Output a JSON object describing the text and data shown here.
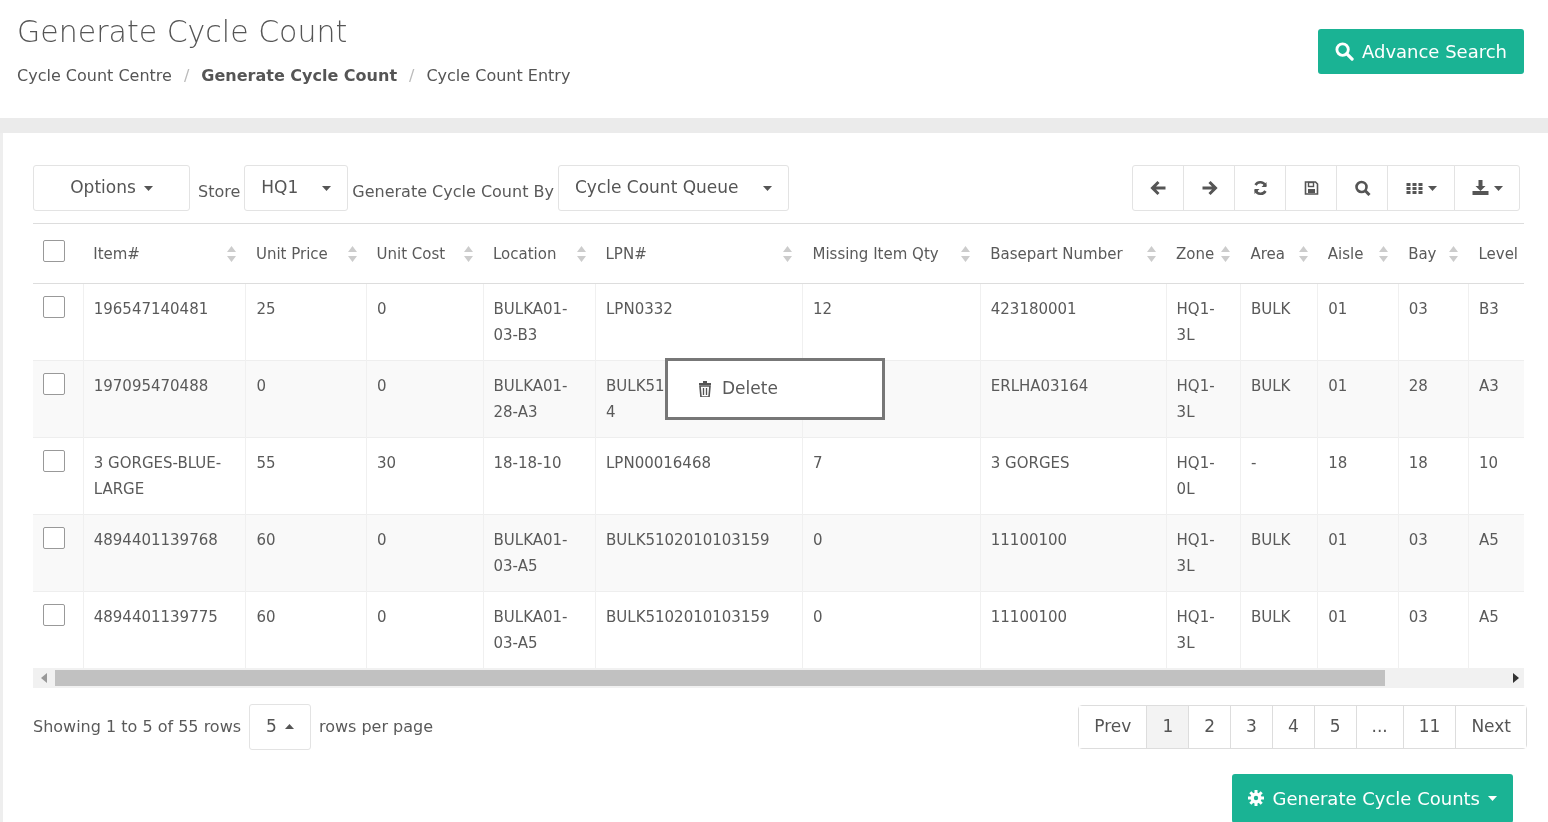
{
  "page_title": "Generate Cycle Count",
  "breadcrumb_separators": [
    "/",
    "/"
  ],
  "breadcrumbs": [
    {
      "label": "Cycle Count Centre",
      "current": false
    },
    {
      "label": "Generate Cycle Count",
      "current": true
    },
    {
      "label": "Cycle Count Entry",
      "current": false
    }
  ],
  "advance_search": {
    "label": "Advance Search"
  },
  "toolbar": {
    "options": "Options",
    "store_label": "Store",
    "store": "HQ1",
    "by_label": "Generate Cycle Count By",
    "by": "Cycle Count Queue"
  },
  "table": {
    "select_all_checked": false,
    "columns": [
      "Item#",
      "Unit Price",
      "Unit Cost",
      "Location",
      "LPN#",
      "Missing Item Qty",
      "Basepart Number",
      "Zone",
      "Area",
      "Aisle",
      "Bay",
      "Level"
    ],
    "rows": [
      {
        "checked": false,
        "cells": [
          "196547140481",
          "25",
          "0",
          "BULKA01-03-B3",
          "LPN0332",
          "12",
          "423180001",
          "HQ1-3L",
          "BULK",
          "01",
          "03",
          "B3"
        ]
      },
      {
        "checked": false,
        "cells": [
          "197095470488",
          "0",
          "0",
          "BULKA01-28-A3",
          "BULK51\n4",
          null,
          "ERLHA03164",
          "HQ1-3L",
          "BULK",
          "01",
          "28",
          "A3"
        ]
      },
      {
        "checked": false,
        "cells": [
          "3 GORGES-BLUE-LARGE",
          "55",
          "30",
          "18-18-10",
          "LPN00016468",
          "7",
          "3 GORGES",
          "HQ1-0L",
          "-",
          "18",
          "18",
          "10"
        ]
      },
      {
        "checked": false,
        "cells": [
          "4894401139768",
          "60",
          "0",
          "BULKA01-03-A5",
          "BULK5102010103159",
          "0",
          "11100100",
          "HQ1-3L",
          "BULK",
          "01",
          "03",
          "A5"
        ]
      },
      {
        "checked": false,
        "cells": [
          "4894401139775",
          "60",
          "0",
          "BULKA01-03-A5",
          "BULK5102010103159",
          "0",
          "11100100",
          "HQ1-3L",
          "BULK",
          "01",
          "03",
          "A5"
        ]
      }
    ]
  },
  "context_menu": {
    "items": [
      {
        "label": "Delete"
      }
    ]
  },
  "footer": {
    "showing": "Showing 1 to 5 of 55 rows",
    "page_size": "5",
    "per_page": "rows per page"
  },
  "pagination": [
    {
      "label": "Prev",
      "selected": false
    },
    {
      "label": "1",
      "selected": true
    },
    {
      "label": "2",
      "selected": false
    },
    {
      "label": "3",
      "selected": false
    },
    {
      "label": "4",
      "selected": false
    },
    {
      "label": "5",
      "selected": false
    },
    {
      "label": "...",
      "selected": false
    },
    {
      "label": "11",
      "selected": false
    },
    {
      "label": "Next",
      "selected": false
    }
  ],
  "generate_button": {
    "label": "Generate Cycle Counts"
  }
}
